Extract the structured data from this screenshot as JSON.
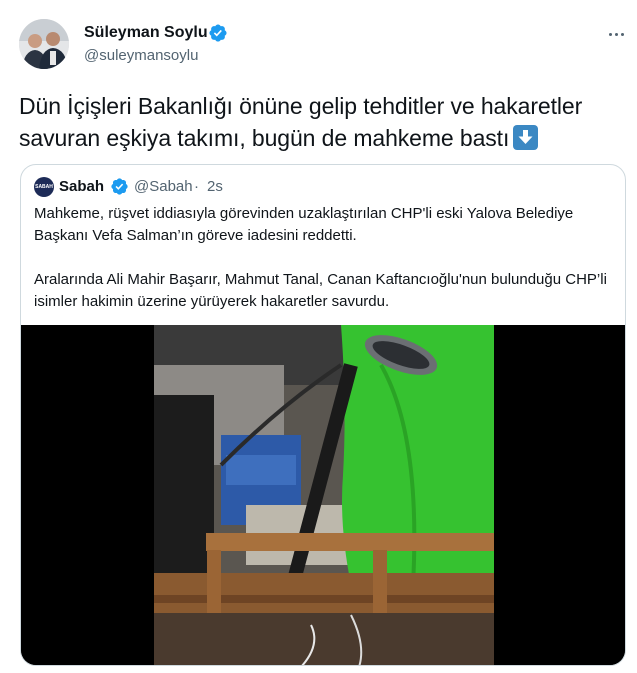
{
  "author": {
    "name": "Süleyman Soylu",
    "handle": "@suleymansoylu"
  },
  "tweet": {
    "text": "Dün İçişleri Bakanlığı önüne gelip tehditler ve hakaretler savuran eşkiya takımı, bugün de mahkeme bastı",
    "emoji": "down-arrow-emoji"
  },
  "quoted": {
    "avatar_text": "SABAH",
    "name": "Sabah",
    "handle": "@Sabah",
    "separator": "·",
    "time": "2s",
    "paragraphs": [
      "Mahkeme, rüşvet iddiasıyla görevinden uzaklaştırılan CHP'li eski Yalova Belediye Başkanı Vefa Salman’ın göreve iadesini reddetti.",
      "Aralarında Ali Mahir Başarır, Mahmut Tanal, Canan Kaftancıoğlu'nun bulunduğu CHP’li isimler hakimin üzerine yürüyerek hakaretler savurdu."
    ]
  },
  "colors": {
    "verified": "#1d9bf0",
    "secondary_text": "#536471",
    "border": "#cfd9de",
    "emoji_blue": "#3b88c3"
  },
  "icons": {
    "verified": "verified-badge-icon",
    "more": "more-horizontal-icon"
  }
}
